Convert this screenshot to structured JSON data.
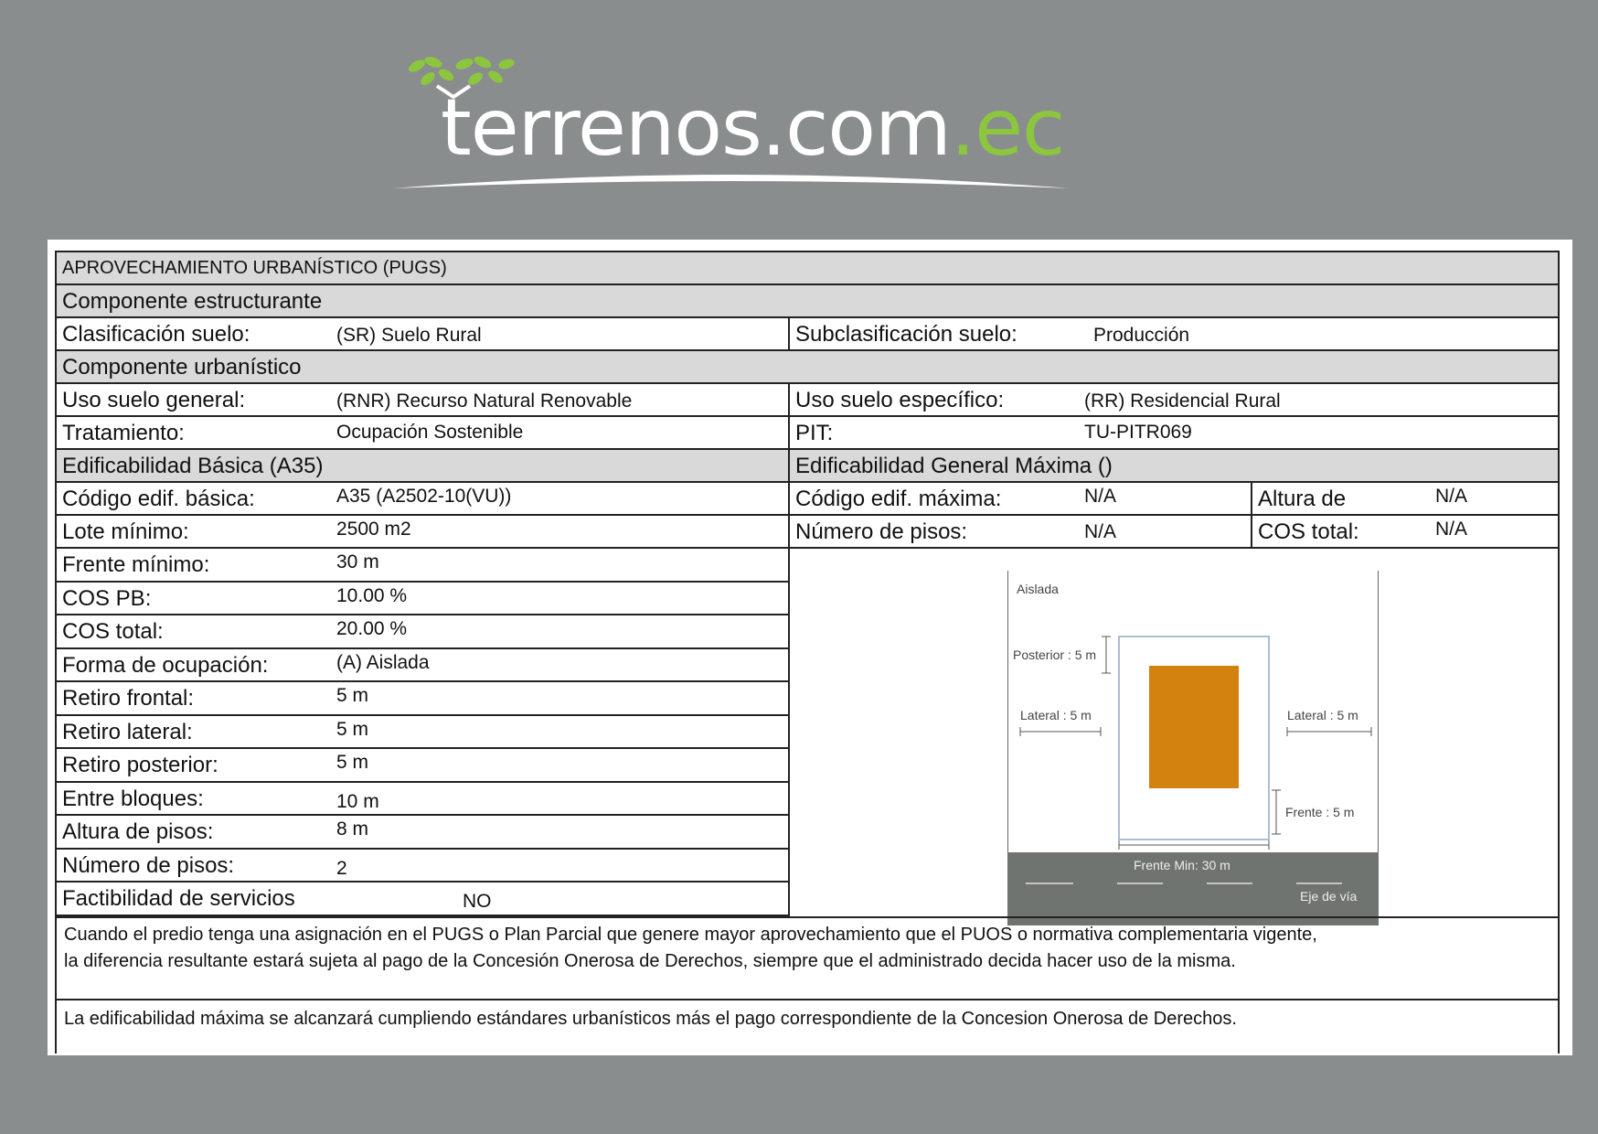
{
  "logo": {
    "name_main": "terrenos.com",
    "name_tld": ".ec"
  },
  "doc": {
    "title": "APROVECHAMIENTO URBANÍSTICO (PUGS)",
    "componente_estructurante": "Componente  estructurante",
    "clasificacion": {
      "label": "Clasificación suelo:",
      "value": "(SR) Suelo Rural"
    },
    "subclasificacion": {
      "label": "Subclasificación suelo:",
      "value": "Producción"
    },
    "componente_urbanistico": "Componente  urbanístico",
    "uso_general": {
      "label": "Uso suelo general:",
      "value": "(RNR) Recurso Natural Renovable"
    },
    "uso_especifico": {
      "label": "Uso suelo específico:",
      "value": "(RR) Residencial Rural"
    },
    "tratamiento": {
      "label": "Tratamiento:",
      "value": "Ocupación Sostenible"
    },
    "pit": {
      "label": "PIT:",
      "value": "TU-PITR069"
    },
    "edif_basica_header": "Edificabilidad Básica (A35)",
    "edif_maxima_header": "Edificabilidad General Máxima ()",
    "codigo_basica": {
      "label": "Código edif. básica:",
      "value": "A35 (A2502-10(VU))"
    },
    "codigo_maxima": {
      "label": "Código edif. máxima:",
      "value": "N/A"
    },
    "altura_de": {
      "label": "Altura de",
      "value": "N/A"
    },
    "lote_minimo": {
      "label": "Lote mínimo:",
      "value": "2500 m2"
    },
    "numero_pisos_max": {
      "label": "Número de pisos:",
      "value": "N/A"
    },
    "cos_total_max": {
      "label": "COS total:",
      "value": "N/A"
    },
    "left_rows": [
      {
        "label": "Frente mínimo:",
        "value": "30 m"
      },
      {
        "label": "COS PB:",
        "value": "10.00 %"
      },
      {
        "label": "COS total:",
        "value": "20.00 %"
      },
      {
        "label": "Forma de ocupación:",
        "value": "(A) Aislada"
      },
      {
        "label": "Retiro frontal:",
        "value": "5 m"
      },
      {
        "label": "Retiro lateral:",
        "value": "5 m"
      },
      {
        "label": "Retiro posterior:",
        "value": "5 m"
      },
      {
        "label": "Entre bloques:",
        "value": "10 m"
      },
      {
        "label": "Altura de pisos:",
        "value": "8 m"
      },
      {
        "label": "Número de pisos:",
        "value": "2"
      },
      {
        "label": "Factibilidad de servicios",
        "value": "NO"
      }
    ],
    "diagram": {
      "title": "Aislada",
      "posterior": "Posterior : 5 m",
      "lateral_left": "Lateral : 5 m",
      "lateral_right": "Lateral : 5 m",
      "frente": "Frente : 5 m",
      "frente_min": "Frente Min: 30 m",
      "eje_via": "Eje de vía",
      "building_color": "#d4820f",
      "road_color": "#6f7471"
    },
    "note1_line1": "Cuando el predio tenga una asignación en el PUGS o Plan Parcial que genere mayor aprovechamiento que el PUOS o normativa complementaria vigente,",
    "note1_line2": "la diferencia resultante estará sujeta al pago de la Concesión Onerosa de Derechos, siempre que el administrado decida hacer uso de la misma.",
    "note2": "La edificabilidad máxima se alcanzará cumpliendo estándares urbanísticos más el pago correspondiente de la Concesion Onerosa de Derechos."
  }
}
